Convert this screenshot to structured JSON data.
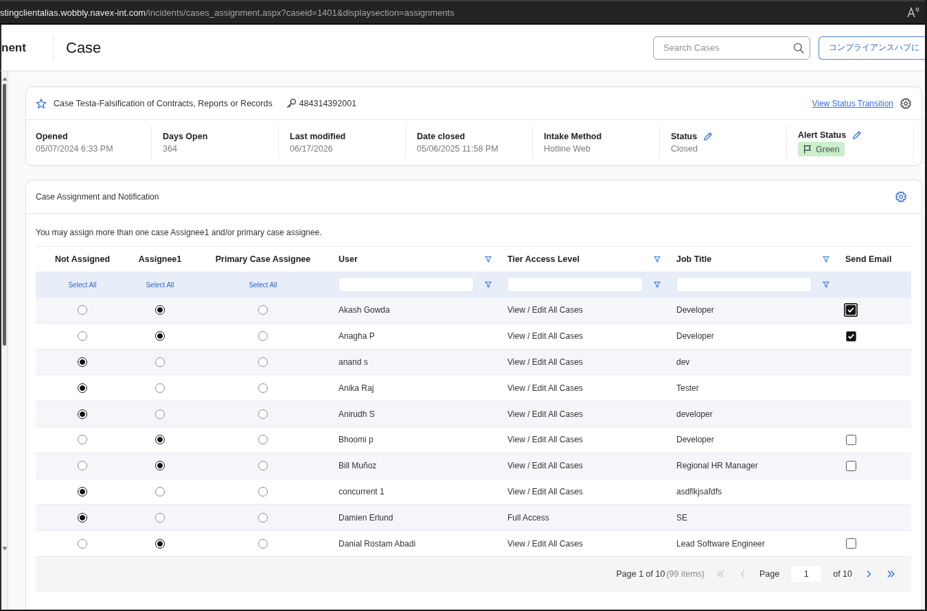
{
  "browser": {
    "url_host": "stingclientalias.wobbly.navex-int.com",
    "url_path": "/incidents/cases_assignment.aspx?caseid=1401&displaysection=assignments"
  },
  "header": {
    "app_name": "nent",
    "title": "Case",
    "search": {
      "placeholder": "Search Cases"
    },
    "hub_button": "コンプライアンスハブに"
  },
  "case_summary": {
    "favorite": false,
    "title": "Case Testa-Falsification of Contracts, Reports or Records",
    "case_number": "484314392001",
    "status_link": "View Status Transition",
    "fields": [
      {
        "kind": "text",
        "label": "Opened",
        "value": "05/07/2024 6:33 PM",
        "editable": false
      },
      {
        "kind": "text",
        "label": "Days Open",
        "value": "364",
        "editable": false
      },
      {
        "kind": "text",
        "label": "Last modified",
        "value": "06/17/2026",
        "editable": false
      },
      {
        "kind": "text",
        "label": "Date closed",
        "value": "05/06/2025 11:58 PM",
        "editable": false
      },
      {
        "kind": "text",
        "label": "Intake Method",
        "value": "Hotline Web",
        "editable": false
      },
      {
        "kind": "text",
        "label": "Status",
        "value": "Closed",
        "editable": true
      },
      {
        "kind": "badge",
        "label": "Alert Status",
        "value": "Green",
        "editable": true,
        "color": "#c8f0cb"
      }
    ]
  },
  "assignment": {
    "title": "Case Assignment and Notification",
    "note": "You may assign more than one case Assignee1 and/or primary case assignee.",
    "table": {
      "columns": [
        {
          "kind": "radio",
          "label": "Not Assigned",
          "select_all": "Select All"
        },
        {
          "kind": "radio",
          "label": "Assignee1",
          "select_all": "Select All"
        },
        {
          "kind": "radio",
          "label": "Primary Case Assignee",
          "select_all": "Select All"
        },
        {
          "kind": "text",
          "label": "User"
        },
        {
          "kind": "text",
          "label": "Tier Access Level"
        },
        {
          "kind": "text",
          "label": "Job Title"
        },
        {
          "kind": "checkbox",
          "label": "Send Email"
        }
      ],
      "rows": [
        {
          "radios": [
            {
              "selected": false
            },
            {
              "selected": true
            },
            {
              "selected": false
            }
          ],
          "user": "Akash Gowda",
          "tier_access_level": "View / Edit All Cases",
          "job_title": "Developer",
          "send_email": {
            "checked": true,
            "focused": true
          }
        },
        {
          "radios": [
            {
              "selected": false
            },
            {
              "selected": true
            },
            {
              "selected": false
            }
          ],
          "user": "Anagha P",
          "tier_access_level": "View / Edit All Cases",
          "job_title": "Developer",
          "send_email": {
            "checked": true,
            "focused": false
          }
        },
        {
          "radios": [
            {
              "selected": true
            },
            {
              "selected": false
            },
            {
              "selected": false
            }
          ],
          "user": "anand s",
          "tier_access_level": "View / Edit All Cases",
          "job_title": "dev"
        },
        {
          "radios": [
            {
              "selected": true
            },
            {
              "selected": false
            },
            {
              "selected": false
            }
          ],
          "user": "Anika Raj",
          "tier_access_level": "View / Edit All Cases",
          "job_title": "Tester"
        },
        {
          "radios": [
            {
              "selected": true
            },
            {
              "selected": false
            },
            {
              "selected": false
            }
          ],
          "user": "Anirudh S",
          "tier_access_level": "View / Edit All Cases",
          "job_title": "developer"
        },
        {
          "radios": [
            {
              "selected": false
            },
            {
              "selected": true
            },
            {
              "selected": false
            }
          ],
          "user": "Bhoomi p",
          "tier_access_level": "View / Edit All Cases",
          "job_title": "Developer",
          "send_email": {
            "checked": false,
            "focused": false
          }
        },
        {
          "radios": [
            {
              "selected": false
            },
            {
              "selected": true
            },
            {
              "selected": false
            }
          ],
          "user": "Bill Muñoz",
          "tier_access_level": "View / Edit All Cases",
          "job_title": "Regional HR Manager",
          "send_email": {
            "checked": false,
            "focused": false
          }
        },
        {
          "radios": [
            {
              "selected": true
            },
            {
              "selected": false
            },
            {
              "selected": false
            }
          ],
          "user": "concurrent 1",
          "tier_access_level": "View / Edit All Cases",
          "job_title": "asdflkjsafdfs"
        },
        {
          "radios": [
            {
              "selected": true
            },
            {
              "selected": false
            },
            {
              "selected": false
            }
          ],
          "user": "Damien Erlund",
          "tier_access_level": "Full Access",
          "job_title": "SE"
        },
        {
          "radios": [
            {
              "selected": false
            },
            {
              "selected": true
            },
            {
              "selected": false
            }
          ],
          "user": "Danial Rostam Abadi",
          "tier_access_level": "View / Edit All Cases",
          "job_title": "Lead Software Engineer",
          "send_email": {
            "checked": false,
            "focused": false
          }
        }
      ]
    },
    "pagination": {
      "summary": "Page 1 of 10",
      "item_count": "(99 items)",
      "page_label": "Page",
      "page_value": "1",
      "total_label": "of 10",
      "buttons": [
        {
          "kind": "first",
          "disabled": true
        },
        {
          "kind": "previous",
          "disabled": true
        },
        {
          "kind": "next",
          "disabled": false
        },
        {
          "kind": "last",
          "disabled": false
        }
      ]
    }
  }
}
